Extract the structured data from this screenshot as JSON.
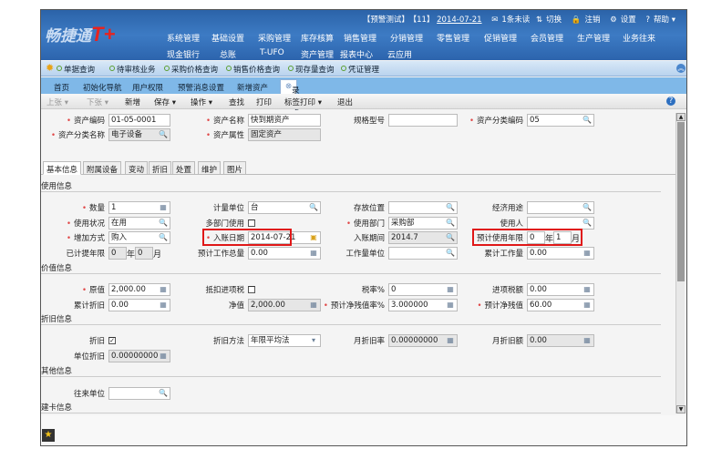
{
  "header": {
    "logo": "畅捷通",
    "logo_mark": "T+",
    "account": "【预警测试】",
    "period": "【11】",
    "date": "2014-07-21",
    "mail": "1条未读",
    "switch": "切换",
    "logout": "注销",
    "settings": "设置",
    "help": "帮助",
    "nav_row1": [
      "系统管理",
      "基础设置",
      "采购管理",
      "库存核算",
      "销售管理",
      "分销管理",
      "零售管理",
      "促销管理",
      "会员管理",
      "生产管理",
      "业务往来"
    ],
    "nav_row2": [
      "现金银行",
      "总账",
      "T-UFO",
      "资产管理",
      "报表中心",
      "云应用"
    ]
  },
  "quickbar": [
    "单据查询",
    "待审核业务",
    "采购价格查询",
    "销售价格查询",
    "现存量查询",
    "凭证管理"
  ],
  "tabs": [
    "首页",
    "初始化导航",
    "用户权限",
    "预警消息设置",
    "新增资产",
    "录入卡片"
  ],
  "toolbar": {
    "prev": "上张 ▾",
    "next": "下张 ▾",
    "new": "新增",
    "save": "保存 ▾",
    "ops": "操作 ▾",
    "find": "查找",
    "print": "打印",
    "label_print": "标签打印 ▾",
    "exit": "退出"
  },
  "head": {
    "code_l": "资产编码",
    "code": "01-05-0001",
    "name_l": "资产名称",
    "name": "快到期资产",
    "spec_l": "规格型号",
    "spec": "",
    "cat_code_l": "资产分类编码",
    "cat_code": "05",
    "cat_name_l": "资产分类名称",
    "cat_name": "电子设备",
    "attr_l": "资产属性",
    "attr": "固定资产"
  },
  "detail_tabs": [
    "基本信息",
    "附属设备",
    "变动",
    "折旧",
    "处置",
    "维护",
    "图片"
  ],
  "usage": {
    "title": "使用信息",
    "qty_l": "数量",
    "qty": "1",
    "unit_l": "计量单位",
    "unit": "台",
    "loc_l": "存放位置",
    "loc": "",
    "purpose_l": "经济用途",
    "purpose": "",
    "status_l": "使用状况",
    "status": "在用",
    "multi_l": "多部门使用",
    "dept_l": "使用部门",
    "dept": "采购部",
    "user_l": "使用人",
    "user": "",
    "add_l": "增加方式",
    "add": "购入",
    "date_l": "入账日期",
    "date": "2014-07-21",
    "period_l": "入账期间",
    "period": "2014.7",
    "life_l": "预计使用年限",
    "life_y": "0",
    "life_m": "1",
    "year": "年",
    "month": "月",
    "accrued_l": "已计提年限",
    "accrued_y": "0",
    "accrued_m": "0",
    "work_total_l": "预计工作总量",
    "work_total": "0.00",
    "work_unit_l": "工作量单位",
    "work_unit": "",
    "work_cum_l": "累计工作量",
    "work_cum": "0.00"
  },
  "value": {
    "title": "价值信息",
    "orig_l": "原值",
    "orig": "2,000.00",
    "deduct_l": "抵扣进项税",
    "tax_l": "税率%",
    "tax": "0",
    "intax_l": "进项税额",
    "intax": "0.00",
    "accdep_l": "累计折旧",
    "accdep": "0.00",
    "net_l": "净值",
    "net": "2,000.00",
    "resrate_l": "预计净残值率%",
    "resrate": "3.000000",
    "res_l": "预计净残值",
    "res": "60.00"
  },
  "dep": {
    "title": "折旧信息",
    "dep_l": "折旧",
    "method_l": "折旧方法",
    "method": "年限平均法",
    "mrate_l": "月折旧率",
    "mrate": "0.00000000",
    "mamt_l": "月折旧额",
    "mamt": "0.00",
    "unit_l": "单位折旧",
    "unit": "0.00000000"
  },
  "other": {
    "title": "其他信息",
    "partner_l": "往来单位",
    "partner": ""
  },
  "card": {
    "title": "建卡信息"
  }
}
